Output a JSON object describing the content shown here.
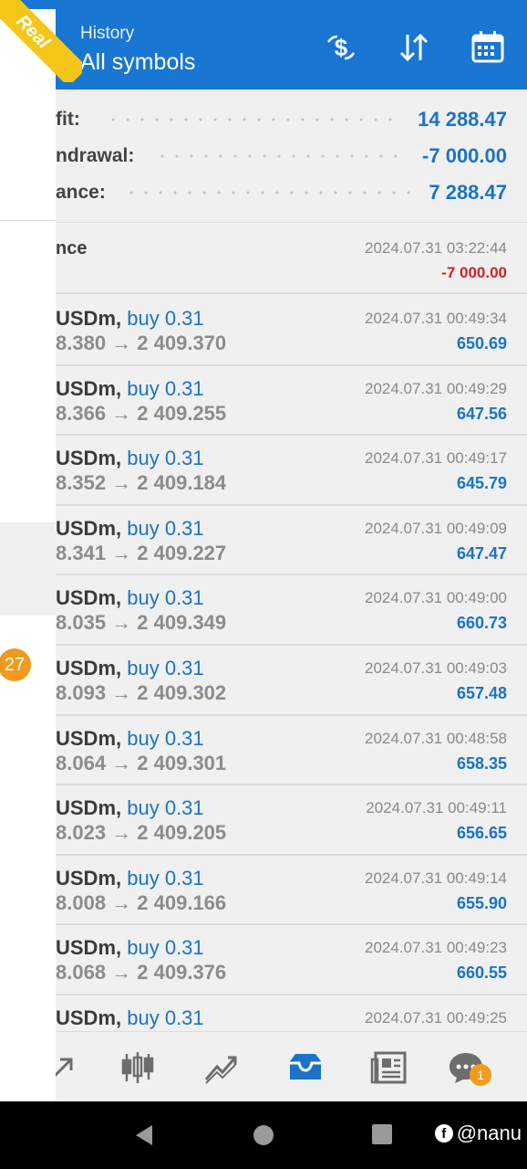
{
  "header": {
    "subtitle": "History",
    "title": "All symbols",
    "accent_color": "#1976d2",
    "icons": [
      "deposit-dollar-icon",
      "sort-icon",
      "calendar-icon"
    ]
  },
  "drawer": {
    "account_ribbon": "Real",
    "badge_count": "27"
  },
  "summary": [
    {
      "label": "fit:",
      "value": "14 288.47"
    },
    {
      "label": "ndrawal:",
      "value": "-7 000.00"
    },
    {
      "label": "ance:",
      "value": "7 288.47"
    }
  ],
  "balance_entry": {
    "label": "nce",
    "time": "2024.07.31 03:22:44",
    "amount": "-7 000.00"
  },
  "trades": [
    {
      "symbol": "USDm,",
      "side": "buy 0.31",
      "prices": "8.380 → 2 409.370",
      "time": "2024.07.31 00:49:34",
      "profit": "650.69"
    },
    {
      "symbol": "USDm,",
      "side": "buy 0.31",
      "prices": "8.366 → 2 409.255",
      "time": "2024.07.31 00:49:29",
      "profit": "647.56"
    },
    {
      "symbol": "USDm,",
      "side": "buy 0.31",
      "prices": "8.352 → 2 409.184",
      "time": "2024.07.31 00:49:17",
      "profit": "645.79"
    },
    {
      "symbol": "USDm,",
      "side": "buy 0.31",
      "prices": "8.341 → 2 409.227",
      "time": "2024.07.31 00:49:09",
      "profit": "647.47"
    },
    {
      "symbol": "USDm,",
      "side": "buy 0.31",
      "prices": "8.035 → 2 409.349",
      "time": "2024.07.31 00:49:00",
      "profit": "660.73"
    },
    {
      "symbol": "USDm,",
      "side": "buy 0.31",
      "prices": "8.093 → 2 409.302",
      "time": "2024.07.31 00:49:03",
      "profit": "657.48"
    },
    {
      "symbol": "USDm,",
      "side": "buy 0.31",
      "prices": "8.064 → 2 409.301",
      "time": "2024.07.31 00:48:58",
      "profit": "658.35"
    },
    {
      "symbol": "USDm,",
      "side": "buy 0.31",
      "prices": "8.023 → 2 409.205",
      "time": "2024.07.31 00:49:11",
      "profit": "656.65"
    },
    {
      "symbol": "USDm,",
      "side": "buy 0.31",
      "prices": "8.008 → 2 409.166",
      "time": "2024.07.31 00:49:14",
      "profit": "655.90"
    },
    {
      "symbol": "USDm,",
      "side": "buy 0.31",
      "prices": "8.068 → 2 409.376",
      "time": "2024.07.31 00:49:23",
      "profit": "660.55"
    },
    {
      "symbol": "USDm,",
      "side": "buy 0.31",
      "prices": "",
      "time": "2024.07.31 00:49:25",
      "profit": ""
    }
  ],
  "bottom_nav": {
    "items": [
      "trade-arrow-icon",
      "candlestick-chart-icon",
      "trend-chart-icon",
      "history-inbox-icon",
      "news-icon",
      "chat-icon"
    ],
    "active": "history-inbox-icon",
    "chat_badge": "1"
  },
  "watermark": {
    "text": "@nanu"
  },
  "colors": {
    "profit_positive": "#1a73c8",
    "profit_negative": "#d32027",
    "badge": "#f29a1d"
  }
}
